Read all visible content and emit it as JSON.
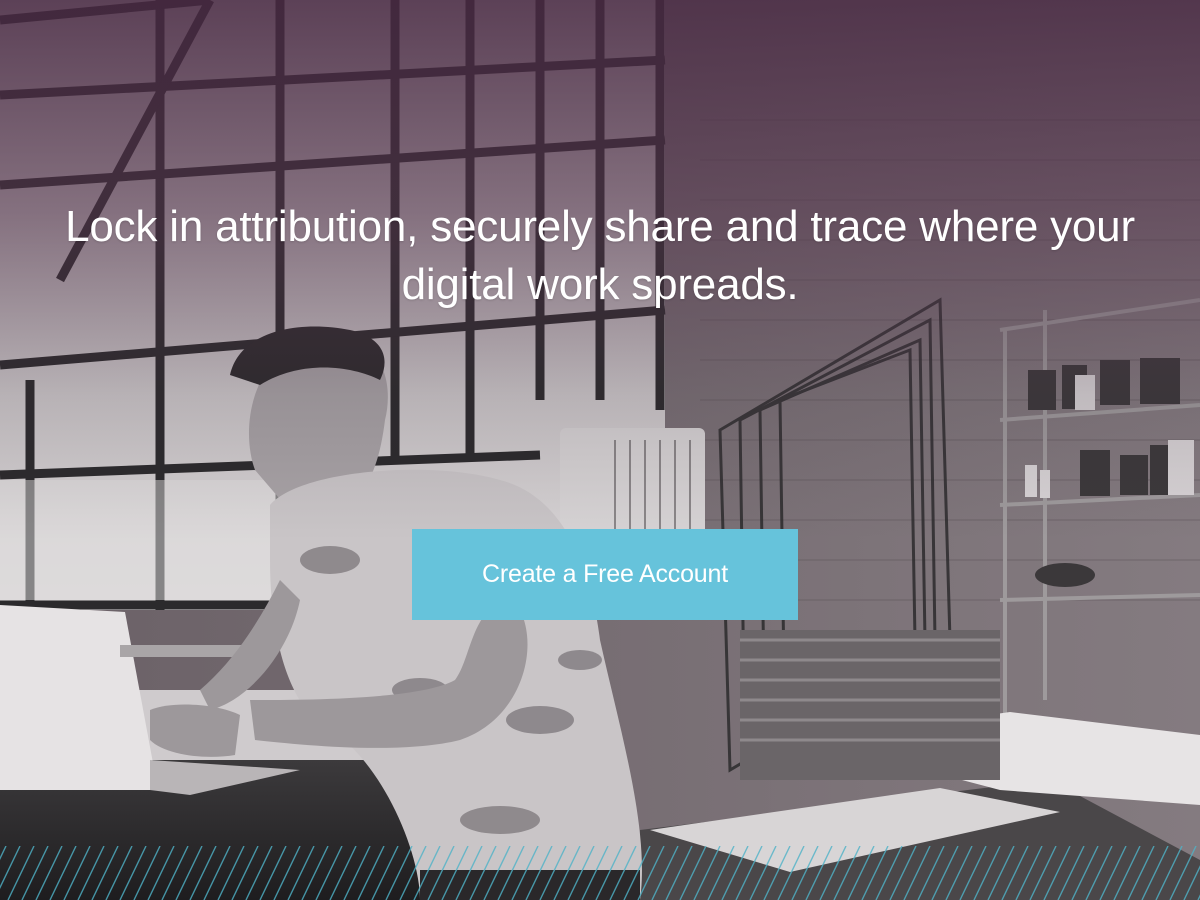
{
  "hero": {
    "headline": "Lock in attribution, securely share and trace where your digital work spreads.",
    "cta_label": "Create a Free Account",
    "background_description_icon": "photo-studio-background"
  },
  "colors": {
    "cta": "#66c3db",
    "tint": "#4a2844",
    "pattern": "#4fb3c8",
    "text": "#ffffff"
  }
}
